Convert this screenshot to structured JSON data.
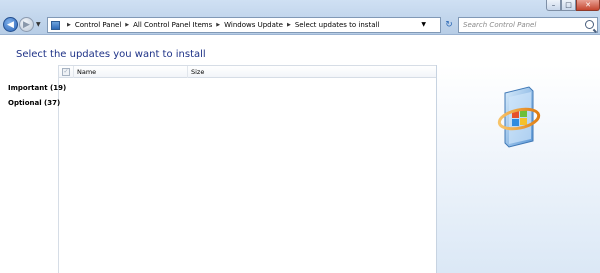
{
  "window": {
    "minimize_symbol": "–",
    "maximize_symbol": "□",
    "close_symbol": "✕"
  },
  "nav": {
    "back_symbol": "◀",
    "forward_symbol": "▶",
    "history_dropdown_symbol": "▼"
  },
  "address": {
    "breadcrumbs": [
      "Control Panel",
      "All Control Panel Items",
      "Windows Update",
      "Select updates to install"
    ],
    "separator": "▶",
    "dropdown_symbol": "▼",
    "refresh_symbol": "↻"
  },
  "search": {
    "placeholder": "Search Control Panel"
  },
  "page": {
    "heading": "Select the updates you want to install"
  },
  "categories": [
    {
      "label": "Important (19)"
    },
    {
      "label": "Optional (37)"
    }
  ],
  "list": {
    "select_all_symbol": "✓",
    "columns": [
      "Name",
      "Size"
    ]
  },
  "colors": {
    "heading": "#1e3287",
    "chrome": "#b7cde6",
    "accent": "#2e6ab6"
  }
}
